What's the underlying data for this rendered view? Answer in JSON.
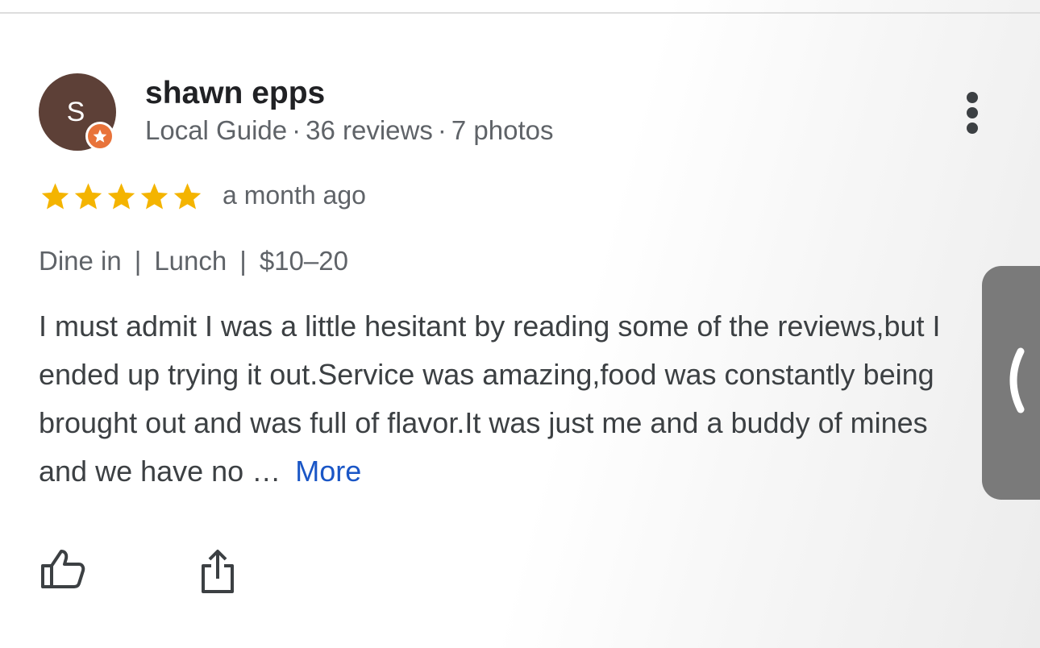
{
  "reviewer": {
    "avatar_letter": "S",
    "name": "shawn epps",
    "badge": "Local Guide",
    "reviews": "36 reviews",
    "photos": "7 photos"
  },
  "rating": {
    "stars": 5,
    "max": 5,
    "time_ago": "a month ago",
    "star_color": "#f4b400"
  },
  "tags": [
    "Dine in",
    "Lunch",
    "$10–20"
  ],
  "review": {
    "text": "I must admit I was a little hesitant by reading some of the reviews,but I ended up trying it out.Service was amazing,food was constantly being brought out and was full of flavor.It was just me and a buddy of mines and we have no …",
    "more_label": "More",
    "link_color": "#1a56c6"
  },
  "actions": {
    "like_icon": "thumbs-up-icon",
    "share_icon": "share-icon"
  },
  "side_panel": {
    "icon": "chevron-left-icon"
  },
  "colors": {
    "avatar_bg": "#5d4037",
    "badge_bg": "#e8733a"
  }
}
